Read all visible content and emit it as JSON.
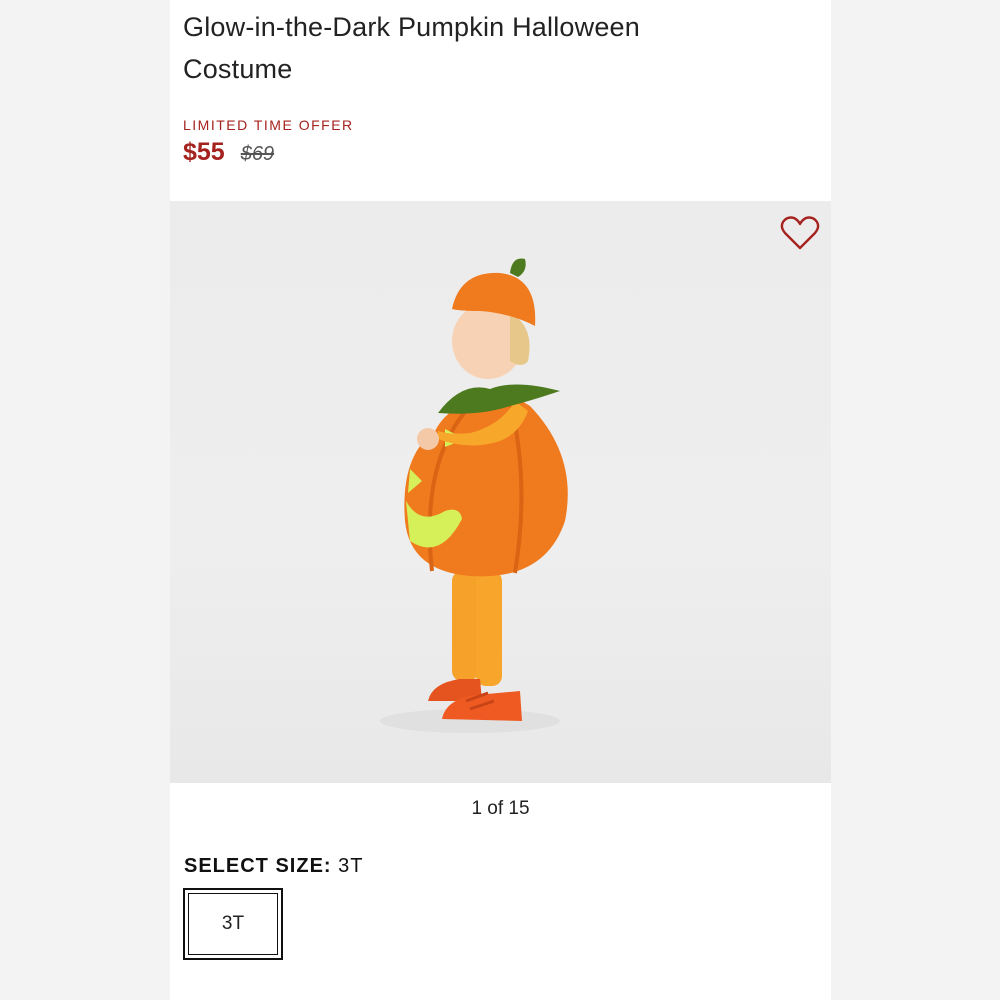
{
  "product": {
    "title_line1": "Glow-in-the-Dark Pumpkin Halloween",
    "title_line2": "Costume",
    "offer_label": "LIMITED TIME OFFER",
    "sale_price": "$55",
    "original_price": "$69"
  },
  "gallery": {
    "counter": "1 of 15",
    "favorite_icon": "heart-outline-icon"
  },
  "size": {
    "label": "SELECT SIZE:",
    "selected": "3T",
    "options": [
      "3T"
    ]
  },
  "colors": {
    "accent": "#a5231f",
    "pumpkin": "#f07a1e",
    "stem": "#4d7a1f",
    "glow": "#d6f05a"
  }
}
